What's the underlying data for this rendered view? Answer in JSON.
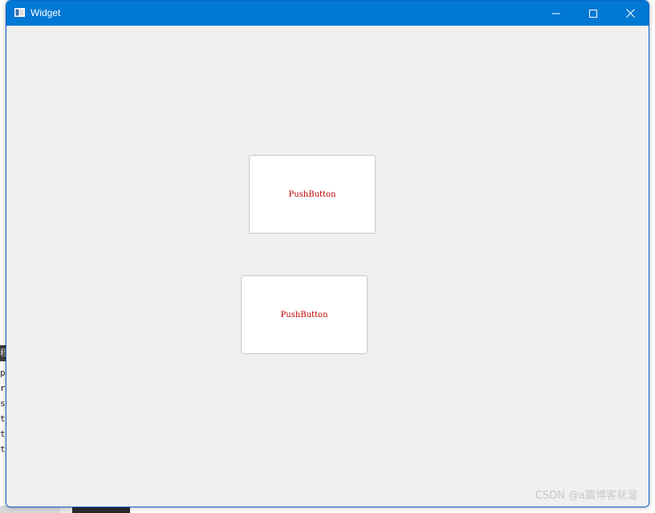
{
  "window": {
    "title": "Widget",
    "controls": {
      "minimize_icon": "minimize-icon",
      "maximize_icon": "maximize-icon",
      "close_icon": "close-icon"
    },
    "titlebar_color": "#0078d4",
    "client_color": "#f0f0f0"
  },
  "buttons": [
    {
      "label": "PushButton",
      "text_color": "#c00000"
    },
    {
      "label": "PushButton",
      "text_color": "#c00000"
    }
  ],
  "background": {
    "mid_glyph": "程",
    "left_lines": [
      "p",
      "r",
      "s",
      "t.",
      "t.",
      "t."
    ]
  },
  "watermark": {
    "text": "CSDN @a篇博客就溜"
  }
}
